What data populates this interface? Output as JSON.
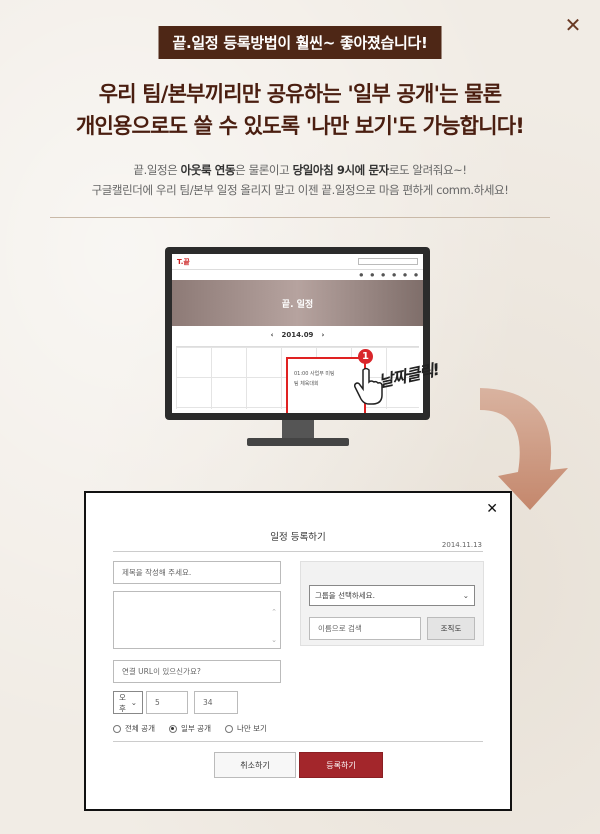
{
  "banner": "끝.일정 등록방법이 훨씬~ 좋아졌습니다!",
  "headline": {
    "line1": "우리 팀/본부끼리만 공유하는 '일부 공개'는 물론",
    "line2": "개인용으로도 쓸 수 있도록 '나만 보기'도 가능합니다!"
  },
  "desc": {
    "l1_a": "끝.일정은 ",
    "l1_b": "아웃룩 연동",
    "l1_c": "은 물론이고 ",
    "l1_d": "당일아침 9시에 문자",
    "l1_e": "로도 알려줘요~!",
    "l2": "구글캘린더에 우리 팀/본부 일정 올리지 말고 이젠 끝.일정으로 마음 편하게 comm.하세요!"
  },
  "monitor": {
    "logo": "T.끝",
    "hero_title": "끝. 일정",
    "month": "2014.09",
    "popup_line1": "01:00 사업부 미팅",
    "popup_line2": "팀 체육대회"
  },
  "callout": {
    "badge": "1",
    "label": "날짜클릭!"
  },
  "dialog": {
    "title": "일정 등록하기",
    "date": "2014.11.13",
    "title_placeholder": "제목을 작성해 주세요.",
    "url_placeholder": "연결 URL이 있으신가요?",
    "ampm": "오후",
    "hour": "5",
    "minute": "34",
    "group_select": "그룹을 선택하세요.",
    "name_search_placeholder": "이름으로 검색",
    "org_button": "조직도",
    "visibility": [
      "전체 공개",
      "일부 공개",
      "나만 보기"
    ],
    "visibility_selected": 1,
    "cancel": "취소하기",
    "submit": "등록하기"
  },
  "colors": {
    "accent": "#a3262b",
    "brand_dark": "#4e2716",
    "highlight": "#e02222"
  }
}
